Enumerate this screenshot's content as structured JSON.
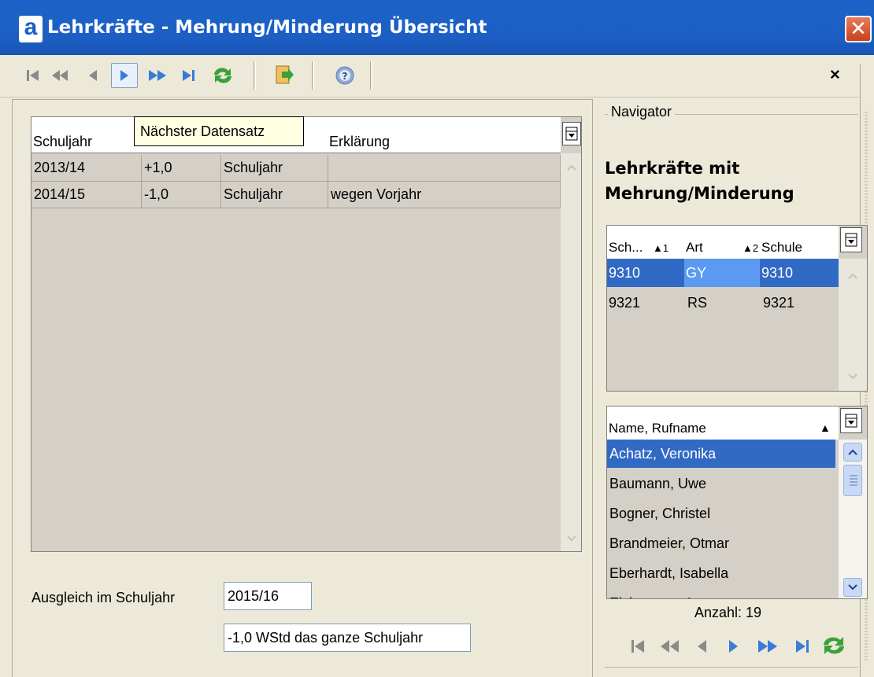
{
  "window": {
    "title": "Lehrkräfte - Mehrung/Minderung Übersicht",
    "logo": "a",
    "close_glyph": "✕"
  },
  "toolbar": {
    "buttons": [
      "first-icon",
      "prev-page-icon",
      "prev-icon",
      "next-icon",
      "next-page-icon",
      "last-icon",
      "refresh-icon",
      "export-icon",
      "help-icon"
    ],
    "close_glyph": "×"
  },
  "tooltip": "Nächster Datensatz",
  "grid": {
    "columns": [
      "Schuljahr",
      "",
      "",
      "Erklärung"
    ],
    "rows": [
      {
        "schuljahr": "2013/14",
        "wert": "+1,0",
        "zeitraum": "Schuljahr",
        "erklaerung": ""
      },
      {
        "schuljahr": "2014/15",
        "wert": "-1,0",
        "zeitraum": "Schuljahr",
        "erklaerung": "wegen Vorjahr"
      }
    ]
  },
  "form": {
    "ausgleich_label": "Ausgleich im Schuljahr",
    "ausgleich_value": "2015/16",
    "summary_value": "-1,0 WStd das ganze Schuljahr"
  },
  "navigator": {
    "legend": "Navigator",
    "title": "Lehrkräfte mit Mehrung/Minderung",
    "schools_grid": {
      "columns": [
        {
          "label": "Sch...",
          "sort": "▲1"
        },
        {
          "label": "Art",
          "sort": "▲2"
        },
        {
          "label": "Schule",
          "sort": ""
        }
      ],
      "rows": [
        {
          "sch": "9310",
          "art": "GY",
          "schule": "9310",
          "selected": true
        },
        {
          "sch": "9321",
          "art": "RS",
          "schule": "9321",
          "selected": false
        }
      ]
    },
    "names_grid": {
      "column": "Name, Rufname",
      "sort": "▲",
      "rows": [
        "Achatz, Veronika",
        "Baumann, Uwe",
        "Bogner, Christel",
        "Brandmeier, Otmar",
        "Eberhardt, Isabella",
        "Eichenseer, Lars"
      ],
      "selected_index": 0
    },
    "count_label": "Anzahl: 19"
  },
  "colors": {
    "titlebar": "#1c5fc4",
    "selection": "#316ac5",
    "tooltip_bg": "#ffffe1"
  }
}
